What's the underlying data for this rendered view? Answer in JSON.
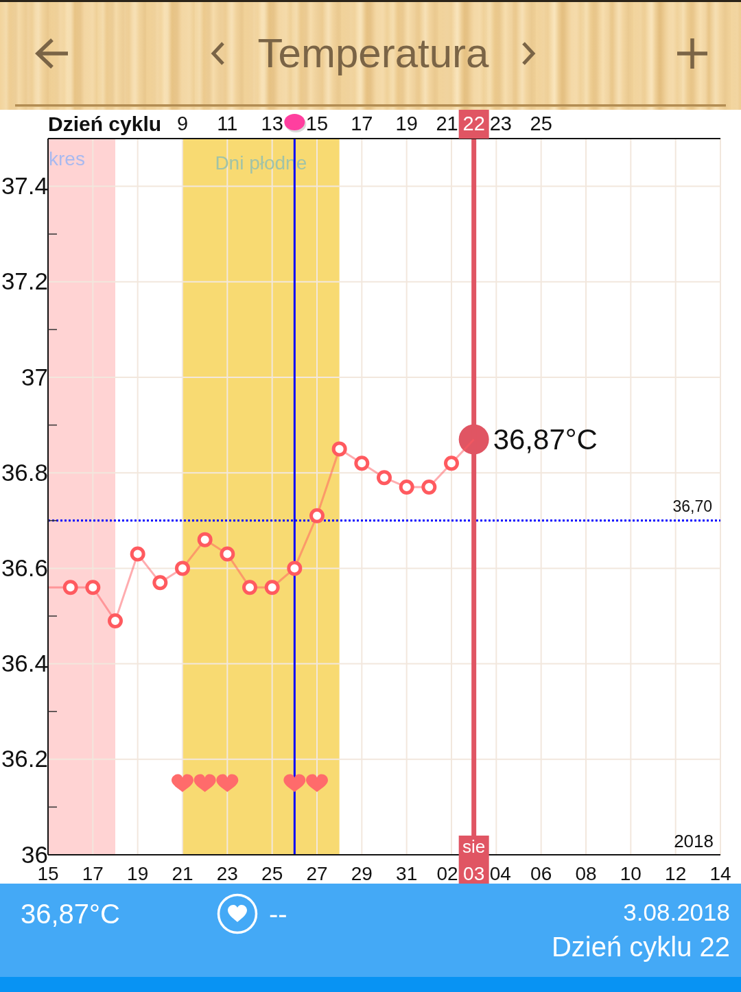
{
  "header": {
    "title": "Temperatura"
  },
  "chart": {
    "chart_data": {
      "type": "line",
      "x2label": "Dzień cyklu",
      "xlabel": "2018",
      "ylim": [
        36,
        37.5
      ],
      "grid": true,
      "yticks": [
        36,
        36.2,
        36.4,
        36.6,
        36.8,
        37,
        37.2,
        37.4
      ],
      "categories": [
        "15",
        null,
        "17",
        null,
        "19",
        null,
        "21",
        null,
        "23",
        null,
        "25",
        null,
        "27",
        null,
        "29",
        null,
        "31",
        null,
        "02",
        "03",
        "04",
        null,
        "06",
        null,
        "08",
        null,
        "10",
        null,
        "12",
        null,
        "14"
      ],
      "x2lim": [
        3,
        33
      ],
      "x2ticks": [
        9,
        11,
        13,
        15,
        17,
        19,
        21,
        22,
        23,
        25
      ],
      "series": [
        {
          "color": "#ff5a5f",
          "marker": "circle",
          "values": [
            null,
            36.56,
            36.56,
            36.49,
            36.63,
            36.57,
            36.6,
            36.66,
            36.63,
            36.56,
            36.56,
            36.6,
            36.71,
            36.85,
            36.82,
            36.79,
            36.77,
            36.77,
            36.82,
            36.87,
            null,
            null,
            null,
            null,
            null,
            null,
            null,
            null,
            null,
            null,
            null
          ]
        },
        {
          "type": "scatter",
          "color": "#ff6b6b",
          "values": [
            null,
            null,
            null,
            null,
            null,
            null,
            36.15,
            36.15,
            36.15,
            null,
            null,
            36.15,
            36.15,
            null,
            null,
            null,
            null,
            null,
            null,
            null,
            null,
            null,
            null,
            null,
            null,
            null,
            null,
            null,
            null,
            null,
            null
          ]
        }
      ],
      "value_labels": [
        null,
        null,
        null,
        null,
        null,
        null,
        null,
        null,
        null,
        null,
        null,
        null,
        null,
        null,
        null,
        null,
        null,
        null,
        null,
        "36,87°C",
        null,
        null,
        null,
        null,
        null,
        null,
        null,
        null,
        null,
        null,
        null
      ],
      "bands": [
        {
          "axis": "x2",
          "from": 3,
          "to": 6,
          "color": "#ffd3d3",
          "label": "kres"
        },
        {
          "axis": "x2",
          "from": 9,
          "to": 16,
          "color": "#f8da72",
          "label": "Dni płodne"
        }
      ],
      "ref_lines": [
        {
          "axis": "x2",
          "value": 14,
          "color": "#0000ff"
        },
        {
          "axis": "y",
          "value": 36.7,
          "color": "#0000ff",
          "label": "36,70"
        },
        {
          "axis": "x2",
          "value": 22,
          "color": "#e05563",
          "label": "sie"
        }
      ]
    }
  },
  "summary": {
    "temperature": "36,87°C",
    "intercourse": "--",
    "date": "3.08.2018",
    "cycle_day": "Dzień cyklu 22"
  }
}
